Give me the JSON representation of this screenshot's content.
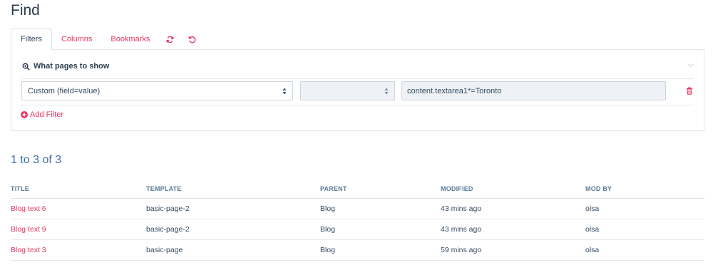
{
  "page": {
    "title": "Find"
  },
  "tabs": {
    "filters": "Filters",
    "columns": "Columns",
    "bookmarks": "Bookmarks",
    "refresh_icon": "refresh-icon",
    "reset_icon": "undo-icon"
  },
  "filters_panel": {
    "header": "What pages to show",
    "header_icon": "search-icon",
    "field_select": "Custom (field=value)",
    "operator_select": "",
    "value_input": "content.textarea1*=Toronto",
    "add_filter_label": "Add Filter"
  },
  "results": {
    "count_text": "1 to 3 of 3",
    "columns": [
      "TITLE",
      "TEMPLATE",
      "PARENT",
      "MODIFIED",
      "MOD BY"
    ],
    "rows": [
      {
        "title": "Blog text 6",
        "template": "basic-page-2",
        "parent": "Blog",
        "modified": "43 mins ago",
        "mod_by": "olsa"
      },
      {
        "title": "Blog text 9",
        "template": "basic-page-2",
        "parent": "Blog",
        "modified": "43 mins ago",
        "mod_by": "olsa"
      },
      {
        "title": "Blog text 3",
        "template": "basic-page",
        "parent": "Blog",
        "modified": "59 mins ago",
        "mod_by": "olsa"
      }
    ]
  },
  "colors": {
    "accent": "#e83561",
    "heading": "#2c3e50",
    "count": "#3f6fa6"
  }
}
